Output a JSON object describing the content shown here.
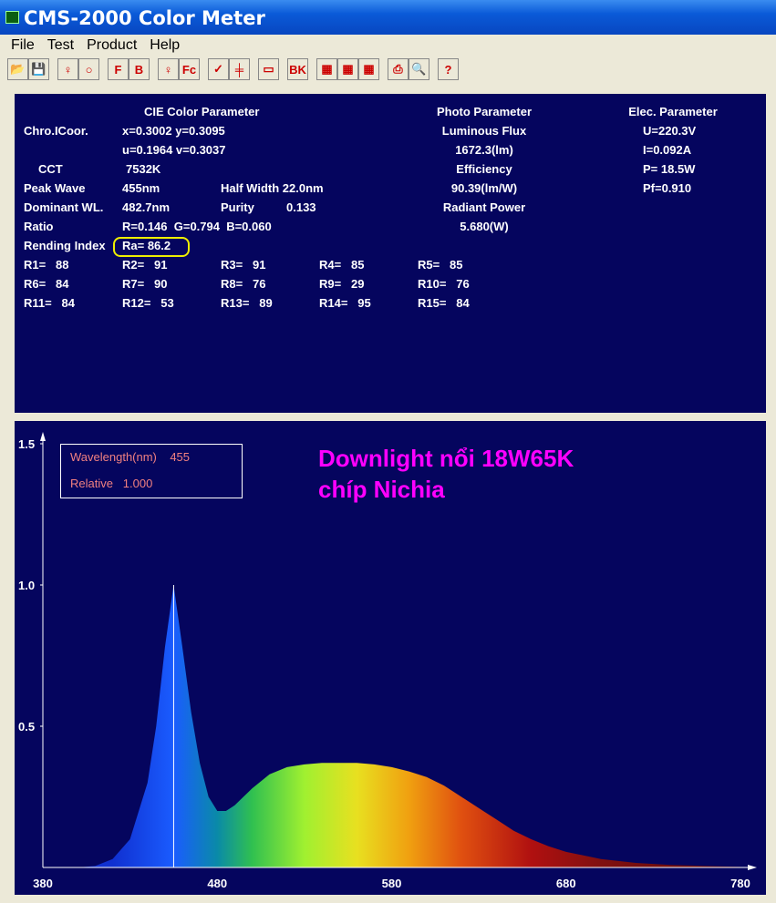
{
  "window": {
    "title": "CMS-2000 Color Meter"
  },
  "menu": [
    "File",
    "Test",
    "Product",
    "Help"
  ],
  "toolbar": [
    {
      "name": "open-icon",
      "g": "📂"
    },
    {
      "name": "save-icon",
      "g": "💾"
    },
    {
      "gap": 1
    },
    {
      "name": "lamp-icon",
      "g": "♀"
    },
    {
      "name": "circle-icon",
      "g": "○"
    },
    {
      "gap": 1
    },
    {
      "name": "lamp-f-icon",
      "g": "F"
    },
    {
      "name": "lamp-b-icon",
      "g": "B"
    },
    {
      "gap": 1
    },
    {
      "name": "bulb-icon",
      "g": "♀"
    },
    {
      "name": "fc-icon",
      "g": "Fc"
    },
    {
      "gap": 1
    },
    {
      "name": "check-icon",
      "g": "✓"
    },
    {
      "name": "ruler-icon",
      "g": "╪"
    },
    {
      "gap": 1
    },
    {
      "name": "chart-icon",
      "g": "▭"
    },
    {
      "gap": 1
    },
    {
      "name": "background-icon",
      "g": "BK"
    },
    {
      "gap": 1
    },
    {
      "name": "export-list-icon",
      "g": "▦"
    },
    {
      "name": "export-save-icon",
      "g": "▦"
    },
    {
      "name": "export-copy-icon",
      "g": "▦"
    },
    {
      "gap": 1
    },
    {
      "name": "print-icon",
      "g": "⎙"
    },
    {
      "name": "print-preview-icon",
      "g": "🔍"
    },
    {
      "gap": 1
    },
    {
      "name": "help-icon",
      "g": "?"
    }
  ],
  "cie": {
    "title": "CIE Color Parameter",
    "chro_label": "Chro.ICoor.",
    "xy": "x=0.3002 y=0.3095",
    "uv": "u=0.1964 v=0.3037",
    "cct_label": "CCT",
    "cct": "7532K",
    "peak_label": "Peak Wave",
    "peak": "455nm",
    "half_width": "Half Width 22.0nm",
    "dom_label": "Dominant WL.",
    "dom": "482.7nm",
    "purity_label": "Purity",
    "purity": "0.133",
    "ratio_label": "Ratio",
    "ratio": "R=0.146  G=0.794  B=0.060",
    "ri_label": "Rending Index",
    "ra": "Ra= 86.2",
    "r": [
      "R1=   88",
      "R2=   91",
      "R3=   91",
      "R4=   85",
      "R5=   85",
      "R6=   84",
      "R7=   90",
      "R8=   76",
      "R9=   29",
      "R10=   76",
      "R11=   84",
      "R12=   53",
      "R13=   89",
      "R14=   95",
      "R15=   84"
    ]
  },
  "photo": {
    "title": "Photo Parameter",
    "flux_label": "Luminous Flux",
    "flux": "1672.3(lm)",
    "eff_label": "Efficiency",
    "eff": "90.39(lm/W)",
    "rp_label": "Radiant Power",
    "rp": "5.680(W)"
  },
  "elec": {
    "title": "Elec. Parameter",
    "u": "U=220.3V",
    "i": "I=0.092A",
    "p": "P= 18.5W",
    "pf": "Pf=0.910"
  },
  "plot": {
    "legend_wl": "Wavelength(nm)    455",
    "legend_rel": "Relative   1.000",
    "annotation1": "Downlight nổi 18W65K",
    "annotation2": "chíp Nichia"
  },
  "chart_data": {
    "type": "area",
    "title": "",
    "xlabel": "Wavelength (nm)",
    "ylabel": "Relative",
    "xlim": [
      380,
      780
    ],
    "ylim": [
      0,
      1.5
    ],
    "xticks": [
      "380",
      "480",
      "580",
      "680",
      "780"
    ],
    "yticks": [
      "0.5",
      "1.0",
      "1.5"
    ],
    "cursor_x": 455,
    "x": [
      400,
      410,
      420,
      430,
      440,
      445,
      450,
      455,
      460,
      465,
      470,
      475,
      480,
      485,
      490,
      500,
      510,
      520,
      530,
      540,
      550,
      560,
      570,
      580,
      590,
      600,
      610,
      620,
      630,
      640,
      650,
      660,
      670,
      680,
      700,
      720,
      740,
      760,
      780
    ],
    "y": [
      0,
      0.005,
      0.03,
      0.1,
      0.3,
      0.5,
      0.78,
      1.0,
      0.78,
      0.55,
      0.37,
      0.25,
      0.2,
      0.2,
      0.22,
      0.28,
      0.33,
      0.355,
      0.365,
      0.37,
      0.37,
      0.37,
      0.365,
      0.355,
      0.34,
      0.32,
      0.29,
      0.25,
      0.21,
      0.17,
      0.13,
      0.1,
      0.075,
      0.055,
      0.03,
      0.016,
      0.009,
      0.005,
      0.002
    ]
  }
}
